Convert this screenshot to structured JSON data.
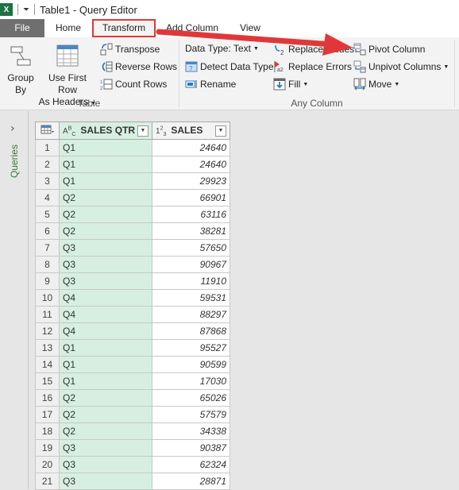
{
  "window": {
    "title": "Table1 - Query Editor",
    "qa_toolbar": "⏷"
  },
  "tabs": [
    {
      "label": "File"
    },
    {
      "label": "Home"
    },
    {
      "label": "Transform",
      "highlighted": true
    },
    {
      "label": "Add Column"
    },
    {
      "label": "View"
    }
  ],
  "ribbon": {
    "table_group": {
      "label": "Table",
      "group_by": "Group\nBy",
      "group_by_l1": "Group",
      "group_by_l2": "By",
      "use_first_row_l1": "Use First Row",
      "use_first_row_l2": "As Headers",
      "transpose": "Transpose",
      "reverse_rows": "Reverse Rows",
      "count_rows": "Count Rows"
    },
    "any_column_group": {
      "label": "Any Column",
      "data_type": "Data Type: Text",
      "detect_data_type": "Detect Data Type",
      "rename": "Rename",
      "replace_values": "Replace Values",
      "replace_errors": "Replace Errors",
      "fill": "Fill",
      "pivot_column": "Pivot Column",
      "unpivot_columns": "Unpivot Columns",
      "move": "Move"
    }
  },
  "annotation": {
    "color": "#e0383a"
  },
  "queries_pane": {
    "label": "Queries"
  },
  "grid": {
    "columns": [
      {
        "type_icon": "ABC",
        "name": "SALES QTR"
      },
      {
        "type_icon": "123",
        "name": "SALES"
      }
    ],
    "rows": [
      {
        "n": "1",
        "qtr": "Q1",
        "sales": "24640"
      },
      {
        "n": "2",
        "qtr": "Q1",
        "sales": "24640"
      },
      {
        "n": "3",
        "qtr": "Q1",
        "sales": "29923"
      },
      {
        "n": "4",
        "qtr": "Q2",
        "sales": "66901"
      },
      {
        "n": "5",
        "qtr": "Q2",
        "sales": "63116"
      },
      {
        "n": "6",
        "qtr": "Q2",
        "sales": "38281"
      },
      {
        "n": "7",
        "qtr": "Q3",
        "sales": "57650"
      },
      {
        "n": "8",
        "qtr": "Q3",
        "sales": "90967"
      },
      {
        "n": "9",
        "qtr": "Q3",
        "sales": "11910"
      },
      {
        "n": "10",
        "qtr": "Q4",
        "sales": "59531"
      },
      {
        "n": "11",
        "qtr": "Q4",
        "sales": "88297"
      },
      {
        "n": "12",
        "qtr": "Q4",
        "sales": "87868"
      },
      {
        "n": "13",
        "qtr": "Q1",
        "sales": "95527"
      },
      {
        "n": "14",
        "qtr": "Q1",
        "sales": "90599"
      },
      {
        "n": "15",
        "qtr": "Q1",
        "sales": "17030"
      },
      {
        "n": "16",
        "qtr": "Q2",
        "sales": "65026"
      },
      {
        "n": "17",
        "qtr": "Q2",
        "sales": "57579"
      },
      {
        "n": "18",
        "qtr": "Q2",
        "sales": "34338"
      },
      {
        "n": "19",
        "qtr": "Q3",
        "sales": "90387"
      },
      {
        "n": "20",
        "qtr": "Q3",
        "sales": "62324"
      },
      {
        "n": "21",
        "qtr": "Q3",
        "sales": "28871"
      }
    ]
  }
}
